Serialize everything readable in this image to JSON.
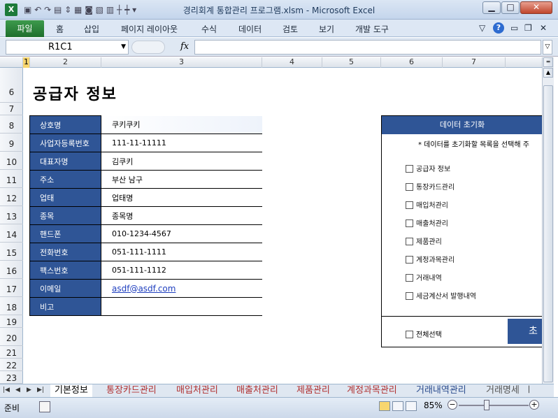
{
  "window": {
    "title": "경리회계 통합관리 프로그램.xlsm  -  Microsoft Excel"
  },
  "ribbon": {
    "file": "파일",
    "tabs": [
      "홈",
      "삽입",
      "페이지 레이아웃",
      "수식",
      "데이터",
      "검토",
      "보기",
      "개발 도구"
    ]
  },
  "formula_bar": {
    "name_box": "R1C1",
    "fx": "fx",
    "formula": ""
  },
  "columns": [
    "1",
    "2",
    "3",
    "4",
    "5",
    "6",
    "7"
  ],
  "rows": [
    "6",
    "7",
    "8",
    "9",
    "10",
    "11",
    "12",
    "13",
    "14",
    "15",
    "16",
    "17",
    "18",
    "19",
    "20",
    "21",
    "22",
    "23"
  ],
  "page_title": "공급자 정보",
  "supplier": [
    {
      "label": "상호명",
      "value": "쿠키쿠키"
    },
    {
      "label": "사업자등록번호",
      "value": "111-11-11111"
    },
    {
      "label": "대표자명",
      "value": "김쿠키"
    },
    {
      "label": "주소",
      "value": "부산 남구"
    },
    {
      "label": "업태",
      "value": "업태명"
    },
    {
      "label": "종목",
      "value": "종목명"
    },
    {
      "label": "핸드폰",
      "value": "010-1234-4567"
    },
    {
      "label": "전화번호",
      "value": "051-111-1111"
    },
    {
      "label": "팩스번호",
      "value": "051-111-1112"
    },
    {
      "label": "이메일",
      "value": "asdf@asdf.com"
    },
    {
      "label": "비고",
      "value": ""
    }
  ],
  "reset_panel": {
    "title": "데이터 초기화",
    "note": "* 데이터를 초기화할 목록을 선택해 주",
    "items": [
      "공급자 정보",
      "통장카드관리",
      "매입처관리",
      "매출처관리",
      "제품관리",
      "계정과목관리",
      "거래내역",
      "세금계산서 발행내역"
    ],
    "select_all": "전체선택",
    "button": "초기"
  },
  "sheet_tabs": [
    "기본정보",
    "통장카드관리",
    "매입처관리",
    "매출처관리",
    "제품관리",
    "계정과목관리",
    "거래내역관리",
    "거래명세"
  ],
  "status": {
    "ready": "준비",
    "zoom": "85%"
  },
  "colors": {
    "accent": "#2f5596",
    "tab_red": "#b03030",
    "tab_blue": "#2a4b8d"
  }
}
